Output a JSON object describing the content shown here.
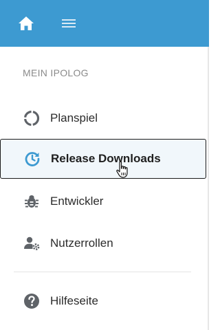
{
  "topbar": {
    "home_icon": "home-icon",
    "menu_icon": "hamburger-menu-icon",
    "background": "#3d9ad1"
  },
  "sidebar": {
    "section_label": "MEIN IPOLOG",
    "items": [
      {
        "label": "Planspiel",
        "icon": "circle-progress-icon",
        "active": false
      },
      {
        "label": "Release Downloads",
        "icon": "history-refresh-icon",
        "active": true
      },
      {
        "label": "Entwickler",
        "icon": "bug-icon",
        "active": false
      },
      {
        "label": "Nutzerrollen",
        "icon": "user-gear-icon",
        "active": false
      },
      {
        "label": "Hilfeseite",
        "icon": "help-circle-icon",
        "active": false
      }
    ]
  },
  "colors": {
    "accent": "#3d9ad1",
    "icon_gray": "#5f6368"
  }
}
